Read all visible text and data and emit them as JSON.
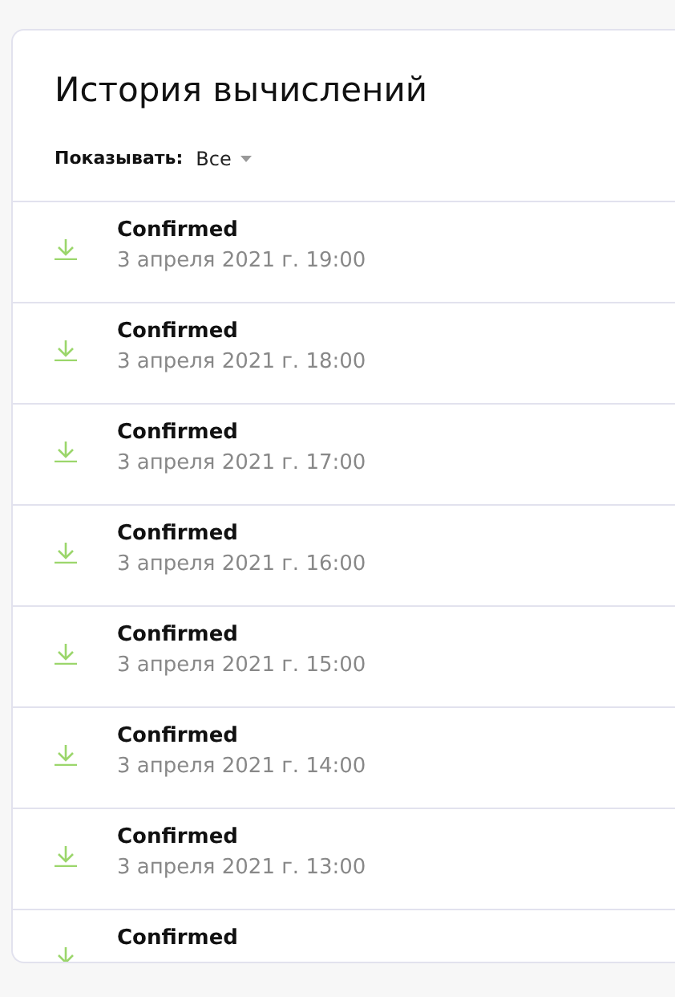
{
  "title": "История вычислений",
  "filter": {
    "label": "Показывать:",
    "value": "Все"
  },
  "items": [
    {
      "kind": "incoming",
      "status": "Confirmed",
      "date": "3 апреля 2021 г. 19:00"
    },
    {
      "kind": "incoming",
      "status": "Confirmed",
      "date": "3 апреля 2021 г. 18:00"
    },
    {
      "kind": "incoming",
      "status": "Confirmed",
      "date": "3 апреля 2021 г. 17:00"
    },
    {
      "kind": "incoming",
      "status": "Confirmed",
      "date": "3 апреля 2021 г. 16:00"
    },
    {
      "kind": "incoming",
      "status": "Confirmed",
      "date": "3 апреля 2021 г. 15:00"
    },
    {
      "kind": "incoming",
      "status": "Confirmed",
      "date": "3 апреля 2021 г. 14:00"
    },
    {
      "kind": "incoming",
      "status": "Confirmed",
      "date": "3 апреля 2021 г. 13:00"
    },
    {
      "kind": "incoming",
      "status": "Confirmed"
    }
  ]
}
